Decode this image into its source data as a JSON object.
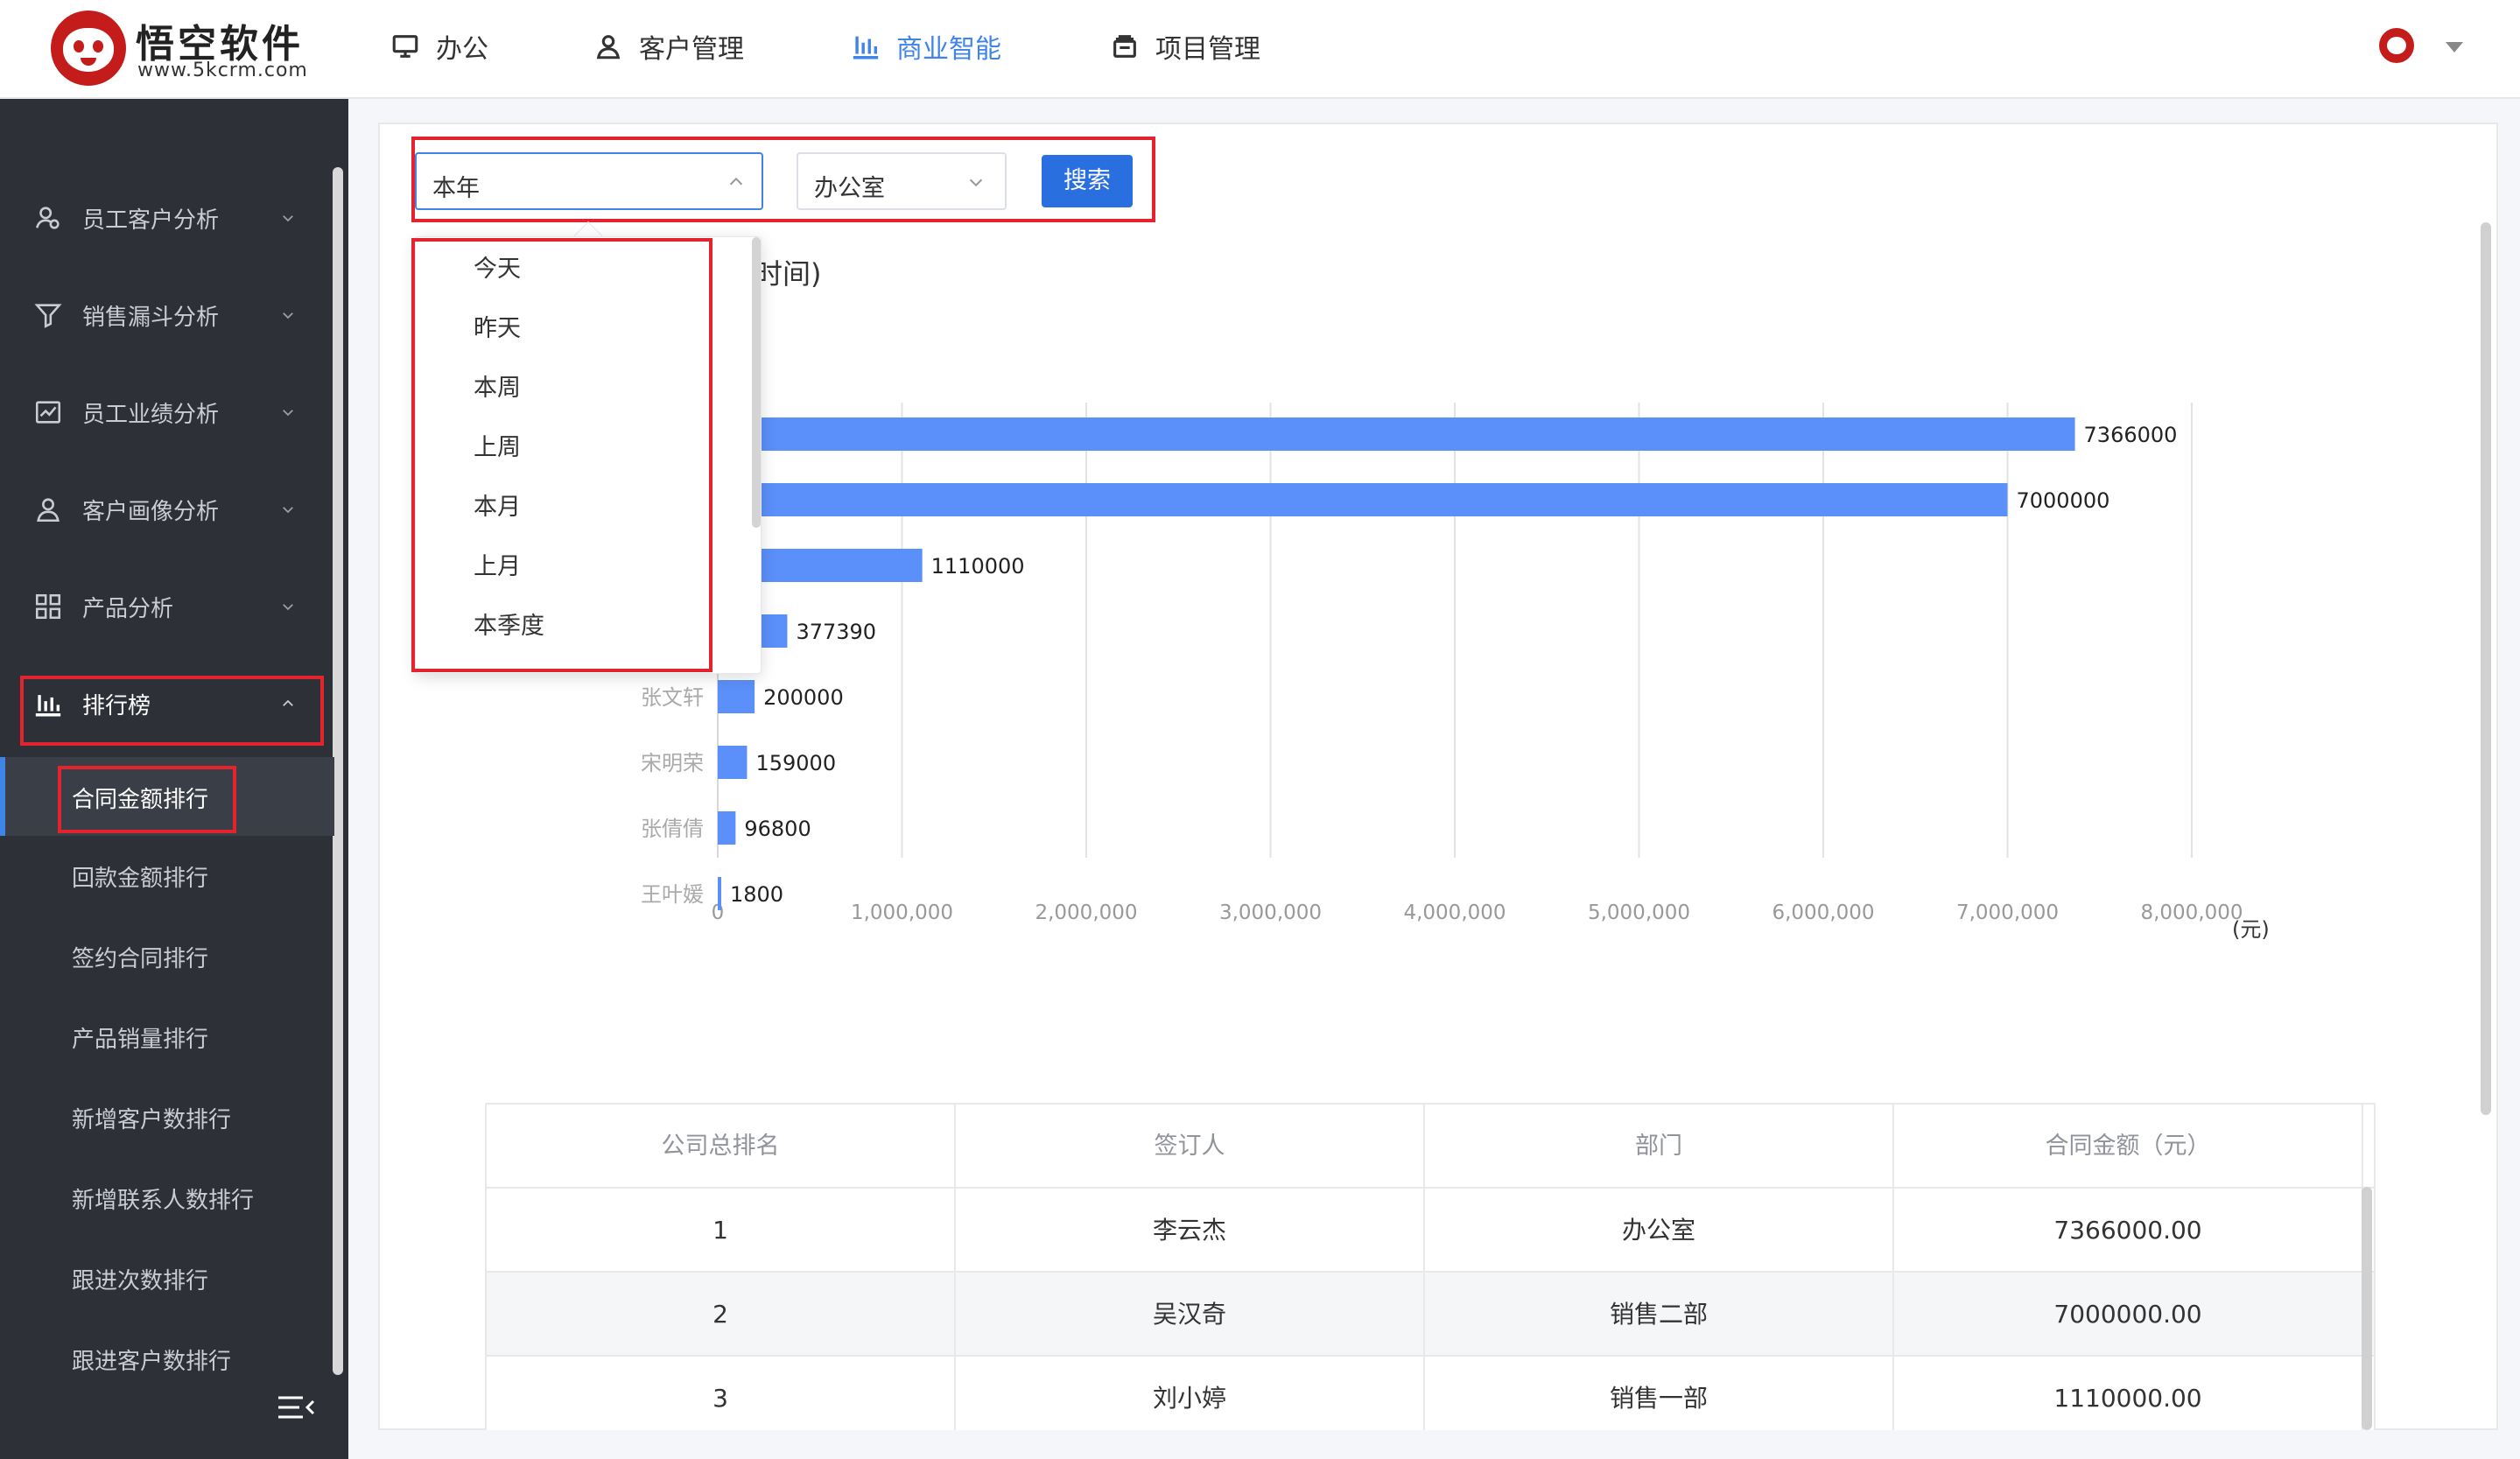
{
  "brand": {
    "name": "悟空软件",
    "url": "www.5kcrm.com",
    "color": "#c41b1b"
  },
  "top_nav": [
    {
      "label": "办公",
      "icon": "monitor-icon",
      "active": false
    },
    {
      "label": "客户管理",
      "icon": "user-icon",
      "active": false
    },
    {
      "label": "商业智能",
      "icon": "bar-chart-icon",
      "active": true
    },
    {
      "label": "项目管理",
      "icon": "project-icon",
      "active": false
    }
  ],
  "accent_color": "#3e84e9",
  "sidebar": {
    "groups": [
      {
        "label": "员工客户分析",
        "icon": "user-analysis-icon"
      },
      {
        "label": "销售漏斗分析",
        "icon": "funnel-icon"
      },
      {
        "label": "员工业绩分析",
        "icon": "performance-icon"
      },
      {
        "label": "客户画像分析",
        "icon": "customer-portrait-icon"
      },
      {
        "label": "产品分析",
        "icon": "product-grid-icon"
      },
      {
        "label": "排行榜",
        "icon": "ranking-icon"
      }
    ],
    "sub_items": [
      {
        "label": "合同金额排行",
        "active": true
      },
      {
        "label": "回款金额排行",
        "active": false
      },
      {
        "label": "签约合同排行",
        "active": false
      },
      {
        "label": "产品销量排行",
        "active": false
      },
      {
        "label": "新增客户数排行",
        "active": false
      },
      {
        "label": "新增联系人数排行",
        "active": false
      },
      {
        "label": "跟进次数排行",
        "active": false
      },
      {
        "label": "跟进客户数排行",
        "active": false
      }
    ]
  },
  "filters": {
    "time_value": "本年",
    "dept_value": "办公室",
    "search_label": "搜索"
  },
  "time_options": [
    "今天",
    "昨天",
    "本周",
    "上周",
    "本月",
    "上月",
    "本季度"
  ],
  "chart_title_visible": "时间)",
  "chart_data": {
    "type": "bar",
    "orientation": "horizontal",
    "categories": [
      "李云杰",
      "吴汉奇",
      "刘小婷",
      "",
      "张文轩",
      "宋明荣",
      "张倩倩",
      "王叶媛"
    ],
    "values": [
      7366000,
      7000000,
      1110000,
      377390,
      200000,
      159000,
      96800,
      1800
    ],
    "xlim": [
      0,
      8000000
    ],
    "x_ticks": [
      "0",
      "1,000,000",
      "2,000,000",
      "3,000,000",
      "4,000,000",
      "5,000,000",
      "6,000,000",
      "7,000,000",
      "8,000,000"
    ],
    "unit_label": "(元)",
    "bar_color": "#5b8ff9",
    "grid": true
  },
  "table": {
    "headers": [
      "公司总排名",
      "签订人",
      "部门",
      "合同金额（元）"
    ],
    "rows": [
      [
        "1",
        "李云杰",
        "办公室",
        "7366000.00"
      ],
      [
        "2",
        "吴汉奇",
        "销售二部",
        "7000000.00"
      ],
      [
        "3",
        "刘小婷",
        "销售一部",
        "1110000.00"
      ]
    ]
  }
}
